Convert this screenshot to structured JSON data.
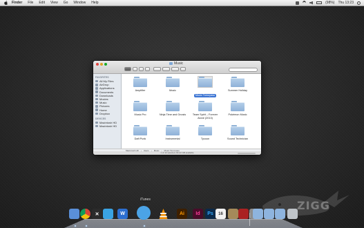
{
  "menubar": {
    "app_name": "Finder",
    "items": [
      "File",
      "Edit",
      "View",
      "Go",
      "Window",
      "Help"
    ],
    "status_text": "(98%)",
    "clock": "Thu 13:23"
  },
  "window": {
    "title": "Music",
    "sidebar": {
      "favorites_header": "FAVORITES",
      "favorites": [
        "All My Files",
        "AirDrop",
        "Applications",
        "Documents",
        "Downloads",
        "Movies",
        "Music",
        "Pictures",
        "Home",
        "Dropbox"
      ],
      "devices_header": "DEVICES",
      "devices": [
        "Macintosh HD",
        "Macintosh HD"
      ]
    },
    "folders": [
      {
        "name": "Amplifier"
      },
      {
        "name": "Music"
      },
      {
        "name": "Music Tomoyasu",
        "selected": true
      },
      {
        "name": "Summer Holiday"
      },
      {
        "name": "Music Pro"
      },
      {
        "name": "Ninja Time and Gnosis"
      },
      {
        "name": "Team Spirit – Forever Alone (2013)"
      },
      {
        "name": "Pokémon Music"
      },
      {
        "name": "Daft Punk"
      },
      {
        "name": "Instrumental"
      },
      {
        "name": "Tycoon"
      },
      {
        "name": "Sound Technician"
      }
    ],
    "path": [
      "Macintosh HD",
      "Users",
      "Music",
      "Music Tomoyasu"
    ],
    "status": "1 of 12 selected, 82,22 GB available"
  },
  "dock": {
    "tooltip": "iTunes",
    "icons": [
      {
        "name": "finder",
        "label": "",
        "color": "#5a8fd8"
      },
      {
        "name": "chrome",
        "label": "",
        "color": "#e8e8e8"
      },
      {
        "name": "x-app",
        "label": "✕",
        "color": "#2b2b2b"
      },
      {
        "name": "twitter",
        "label": "",
        "color": "#3aa3e3"
      },
      {
        "name": "word",
        "label": "W",
        "color": "#2d6fd1"
      },
      {
        "name": "itunes",
        "label": "",
        "color": "#4ba3e6"
      },
      {
        "name": "vlc",
        "label": "",
        "color": "#f08c00"
      },
      {
        "name": "illustrator",
        "label": "Ai",
        "color": "#3d1f00"
      },
      {
        "name": "indesign",
        "label": "Id",
        "color": "#4a0c2a"
      },
      {
        "name": "photoshop",
        "label": "Ps",
        "color": "#0b2a4a"
      },
      {
        "name": "calendar",
        "label": "16",
        "color": "#f2f2f2"
      },
      {
        "name": "preview",
        "label": "",
        "color": "#a58a5a"
      },
      {
        "name": "photo-booth",
        "label": "",
        "color": "#aa2222"
      },
      {
        "name": "system-preferences",
        "label": "",
        "color": "#8d8d8d"
      },
      {
        "name": "folder-1",
        "label": "",
        "color": "#8eb4de"
      },
      {
        "name": "folder-2",
        "label": "",
        "color": "#8eb4de"
      },
      {
        "name": "folder-3",
        "label": "",
        "color": "#8eb4de"
      },
      {
        "name": "trash",
        "label": "",
        "color": "#bfc4c9"
      }
    ]
  },
  "watermark": {
    "text": "ZIGG"
  }
}
